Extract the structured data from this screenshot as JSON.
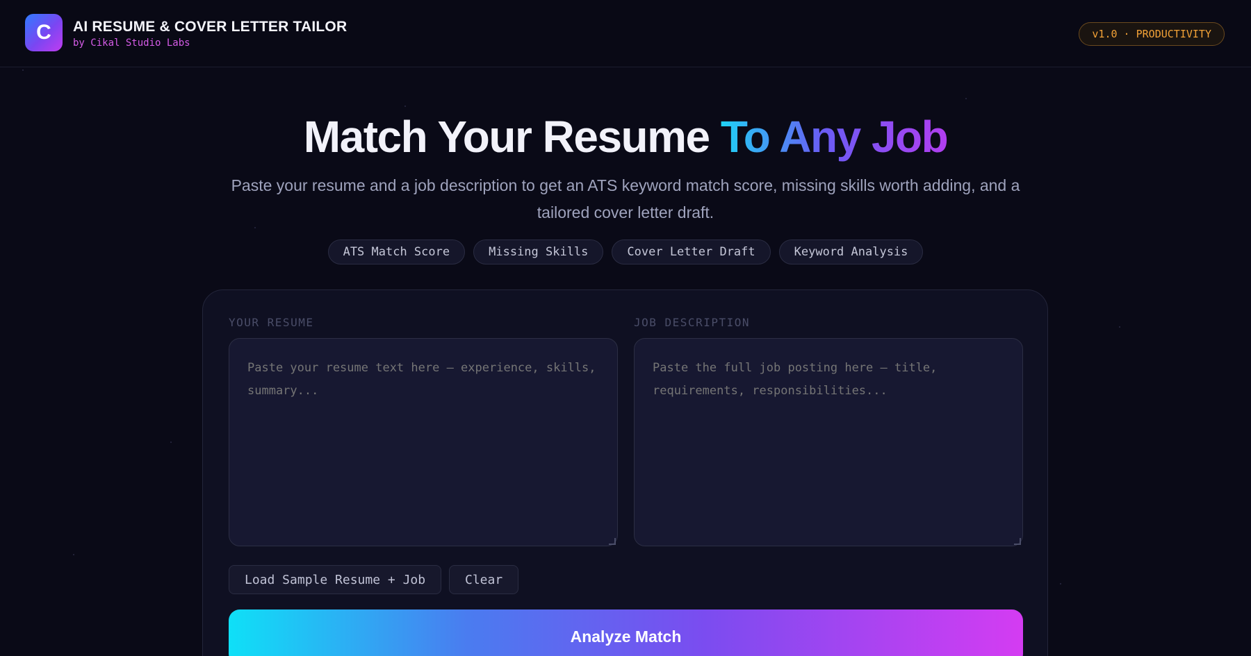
{
  "header": {
    "logo_letter": "C",
    "title": "AI RESUME & COVER LETTER TAILOR",
    "subtitle": "by Cikal Studio Labs",
    "version_badge": "v1.0 · PRODUCTIVITY"
  },
  "hero": {
    "title_plain": "Match Your Resume ",
    "title_gradient": "To Any Job",
    "description": "Paste your resume and a job description to get an ATS keyword match score, missing skills worth adding, and a tailored cover letter draft.",
    "features": [
      "ATS Match Score",
      "Missing Skills",
      "Cover Letter Draft",
      "Keyword Analysis"
    ]
  },
  "form": {
    "resume_label": "YOUR RESUME",
    "resume_placeholder": "Paste your resume text here — experience, skills, summary...",
    "resume_value": "",
    "job_label": "JOB DESCRIPTION",
    "job_placeholder": "Paste the full job posting here — title, requirements, responsibilities...",
    "job_value": "",
    "load_sample_label": "Load Sample Resume + Job",
    "clear_label": "Clear",
    "analyze_label": "Analyze Match"
  },
  "colors": {
    "background": "#0a0a17",
    "brand_subtitle": "#d65ce8",
    "badge_accent": "#f3a237",
    "gradient_start": "#0fe0f7",
    "gradient_end": "#d43cf2"
  }
}
